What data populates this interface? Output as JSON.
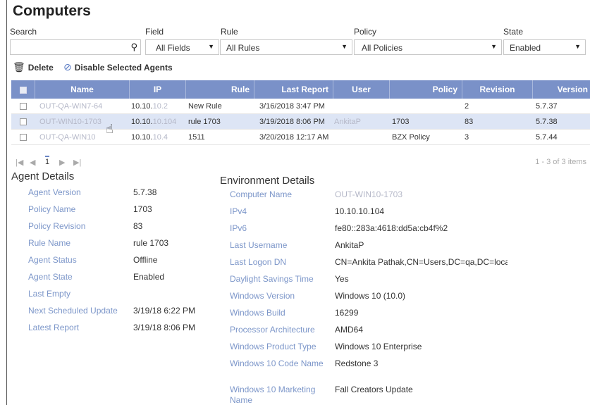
{
  "page": {
    "title": "Computers"
  },
  "filters": {
    "search_label": "Search",
    "search_value": "",
    "field_label": "Field",
    "field_value": "All Fields",
    "rule_label": "Rule",
    "rule_value": "All Rules",
    "policy_label": "Policy",
    "policy_value": "All Policies",
    "state_label": "State",
    "state_value": "Enabled"
  },
  "toolbar": {
    "delete_label": "Delete",
    "disable_label": "Disable Selected Agents"
  },
  "grid": {
    "columns": [
      "Name",
      "IP",
      "Rule",
      "Last Report",
      "User",
      "Policy",
      "Revision",
      "Version"
    ],
    "rows": [
      {
        "name": "OUT-QA-WIN7-64",
        "ip_prefix": "10.10.",
        "ip_suffix": "10.2",
        "rule": "New Rule",
        "last_report": "3/16/2018 3:47 PM",
        "user": "",
        "policy": "",
        "revision": "2",
        "version": "5.7.37"
      },
      {
        "name": "OUT-WIN10-1703",
        "ip_prefix": "10.10.",
        "ip_suffix": "10.104",
        "rule": "rule 1703",
        "last_report": "3/19/2018 8:06 PM",
        "user": "AnkitaP",
        "policy": "1703",
        "revision": "83",
        "version": "5.7.38"
      },
      {
        "name": "OUT-QA-WIN10",
        "ip_prefix": "10.10.",
        "ip_suffix": "10.4",
        "rule": "1511",
        "last_report": "3/20/2018 12:17 AM",
        "user": "",
        "policy": "BZX Policy",
        "revision": "3",
        "version": "5.7.44"
      }
    ]
  },
  "pager": {
    "first": "|◀",
    "prev": "◀",
    "current": "1",
    "next": "▶",
    "last": "▶|",
    "summary": "1 - 3 of 3 items"
  },
  "agent_details": {
    "title": "Agent Details",
    "items": [
      {
        "label": "Agent Version",
        "value": "5.7.38"
      },
      {
        "label": "Policy Name",
        "value": "1703"
      },
      {
        "label": "Policy Revision",
        "value": "83"
      },
      {
        "label": "Rule Name",
        "value": "rule 1703"
      },
      {
        "label": "Agent Status",
        "value": "Offline"
      },
      {
        "label": "Agent State",
        "value": "Enabled"
      },
      {
        "label": "Last Empty",
        "value": ""
      },
      {
        "label": "Next Scheduled Update",
        "value": "3/19/18 6:22 PM"
      },
      {
        "label": "Latest Report",
        "value": "3/19/18 8:06 PM"
      }
    ]
  },
  "env_details": {
    "title": "Environment Details",
    "items": [
      {
        "label": "Computer Name",
        "value": "OUT-WIN10-1703"
      },
      {
        "label": "IPv4",
        "value": "10.10.10.104"
      },
      {
        "label": "IPv6",
        "value": "fe80::283a:4618:dd5a:cb4f%2"
      },
      {
        "label": "Last Username",
        "value": "AnkitaP"
      },
      {
        "label": "Last Logon DN",
        "value": "CN=Ankita Pathak,CN=Users,DC=qa,DC=local"
      },
      {
        "label": "Daylight Savings Time",
        "value": "Yes"
      },
      {
        "label": "Windows Version",
        "value": "Windows 10 (10.0)"
      },
      {
        "label": "Windows Build",
        "value": "16299"
      },
      {
        "label": "Processor Architecture",
        "value": "AMD64"
      },
      {
        "label": "Windows Product Type",
        "value": "Windows 10 Enterprise"
      },
      {
        "label": "Windows 10 Code Name",
        "value": "Redstone 3"
      },
      {
        "label": "Windows 10 Marketing Name",
        "value": "Fall Creators Update"
      }
    ]
  },
  "icons": {
    "search": "search-icon",
    "trash": "trash-icon",
    "disable": "disable-icon",
    "dropdown": "chevron-down-icon"
  },
  "colors": {
    "header_bg": "#7a91c8",
    "selected_row": "#dde5f5",
    "label_blue": "#7c96c9"
  }
}
